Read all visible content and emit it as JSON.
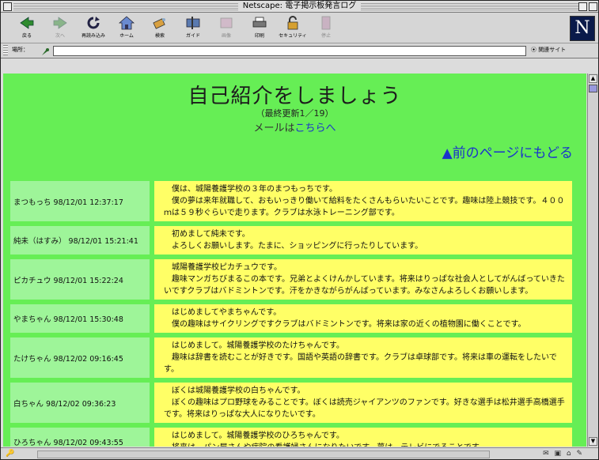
{
  "window": {
    "title": "Netscape: 電子掲示板発言ログ"
  },
  "toolbar": {
    "buttons": [
      {
        "label": "戻る",
        "icon": "back-arrow-icon",
        "enabled": true
      },
      {
        "label": "次へ",
        "icon": "forward-arrow-icon",
        "enabled": false
      },
      {
        "label": "再読み込み",
        "icon": "reload-icon",
        "enabled": true
      },
      {
        "label": "ホーム",
        "icon": "home-icon",
        "enabled": true
      },
      {
        "label": "検索",
        "icon": "search-icon",
        "enabled": true
      },
      {
        "label": "ガイド",
        "icon": "guide-icon",
        "enabled": true
      },
      {
        "label": "画像",
        "icon": "images-icon",
        "enabled": false
      },
      {
        "label": "印刷",
        "icon": "print-icon",
        "enabled": true
      },
      {
        "label": "セキュリティ",
        "icon": "security-lock-icon",
        "enabled": true
      },
      {
        "label": "停止",
        "icon": "stop-icon",
        "enabled": false
      }
    ]
  },
  "location": {
    "label": "場所：",
    "value": "",
    "related_label": "関連サイト"
  },
  "page": {
    "title": "自己紹介をしましょう",
    "updated": "（最終更新1／19）",
    "mail_prefix": "メールは",
    "mail_link": "こちらへ",
    "back_link": "▲前のページにもどる"
  },
  "posts": [
    {
      "who": "まつもっち 98/12/01 12:37:17",
      "msg": "　僕は、城陽養護学校の３年のまつもっちです。\n　僕の夢は来年就職して、おもいっきり働いて給料をたくさんもらいたいことです。趣味は陸上競技です。４００ｍは５９秒ぐらいで走ります。クラブは水泳トレーニング部です。"
    },
    {
      "who": "純未（はすみ） 98/12/01 15:21:41",
      "msg": "　初めまして純未です。\n　よろしくお願いします。たまに、ショッピングに行ったりしています。"
    },
    {
      "who": "ピカチュウ 98/12/01 15:22:24",
      "msg": "　城陽養護学校ピカチュウです。\n　趣味マンガちびまるこの本です。兄弟とよくけんかしています。将来はりっぱな社会人としてがんばっていきたいですクラブはバドミントンです。汗をかきながらがんばっています。みなさんよろしくお願いします。"
    },
    {
      "who": "やまちゃん 98/12/01 15:30:48",
      "msg": "　はじめましてやまちゃんです。\n　僕の趣味はサイクリングですクラブはバドミントンです。将来は家の近くの植物園に働くことです。"
    },
    {
      "who": "たけちゃん 98/12/02 09:16:45",
      "msg": "　はじめまして。城陽養護学校のたけちゃんです。\n　趣味は辞書を読むことが好きです。国語や英語の辞書です。クラブは卓球部です。将来は車の運転をしたいです。"
    },
    {
      "who": "白ちゃん 98/12/02 09:36:23",
      "msg": "　ぼくは城陽養護学校の白ちゃんです。\n　ぼくの趣味はプロ野球をみることです。ぼくは読売ジャイアンツのファンです。好きな選手は松井選手高橋選手です。将来はりっぱな大人になりたいです。"
    },
    {
      "who": "ひろちゃん 98/12/02 09:43:55",
      "msg": "　はじめまして。城陽養護学校のひろちゃんです。\n　将来は、パン屋さんや病院の看護婦さんになりたいです。夢は、テレビにでることです。"
    }
  ]
}
